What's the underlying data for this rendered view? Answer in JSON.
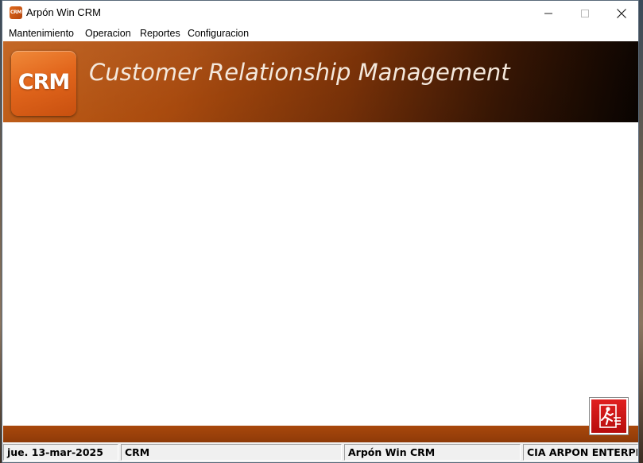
{
  "window": {
    "title": "Arpón Win CRM",
    "app_icon_text": "CRM",
    "minimize_icon": "minimize-icon",
    "maximize_icon": "maximize-icon",
    "close_icon": "close-icon"
  },
  "menu": {
    "items": [
      {
        "label": "Mantenimiento"
      },
      {
        "label": "Operacion"
      },
      {
        "label": "Reportes"
      },
      {
        "label": "Configuracion"
      }
    ]
  },
  "banner": {
    "logo_text": "CRM",
    "title": "Customer Relationship Management",
    "colors": {
      "accent": "#c2571a",
      "dark": "#0a0401"
    }
  },
  "exit_button": {
    "icon": "exit-run-icon",
    "color": "#c81414"
  },
  "statusbar": {
    "panels": [
      {
        "text": "jue. 13-mar-2025"
      },
      {
        "text": "CRM"
      },
      {
        "text": "Arpón Win CRM"
      },
      {
        "text": "CIA ARPON ENTERPRISE"
      }
    ]
  }
}
